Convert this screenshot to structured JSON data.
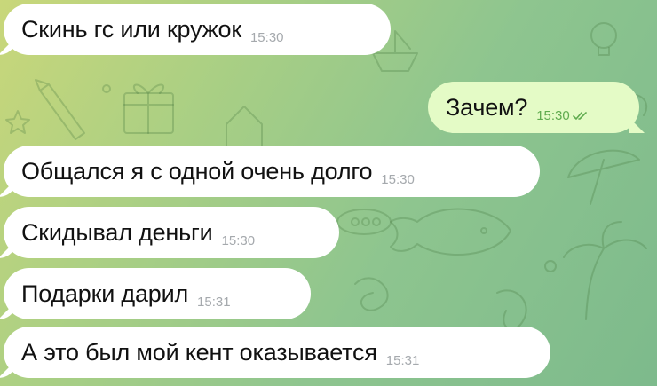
{
  "chat": {
    "messages": [
      {
        "text": "Скинь гс или кружок",
        "time": "15:30",
        "direction": "incoming"
      },
      {
        "text": "Зачем?",
        "time": "15:30",
        "direction": "outgoing",
        "status_icon": "double-check-icon"
      },
      {
        "text": "Общался я с одной очень долго",
        "time": "15:30",
        "direction": "incoming"
      },
      {
        "text": "Скидывал деньги",
        "time": "15:30",
        "direction": "incoming"
      },
      {
        "text": "Подарки дарил",
        "time": "15:31",
        "direction": "incoming"
      },
      {
        "text": "А это был мой кент оказывается",
        "time": "15:31",
        "direction": "incoming"
      }
    ]
  },
  "colors": {
    "incoming_bubble": "#ffffff",
    "outgoing_bubble": "#e4fbc6",
    "outgoing_time": "#5fab4e",
    "incoming_time": "#a5a9ad",
    "background_start": "#c9d77a",
    "background_end": "#7dba8c"
  }
}
